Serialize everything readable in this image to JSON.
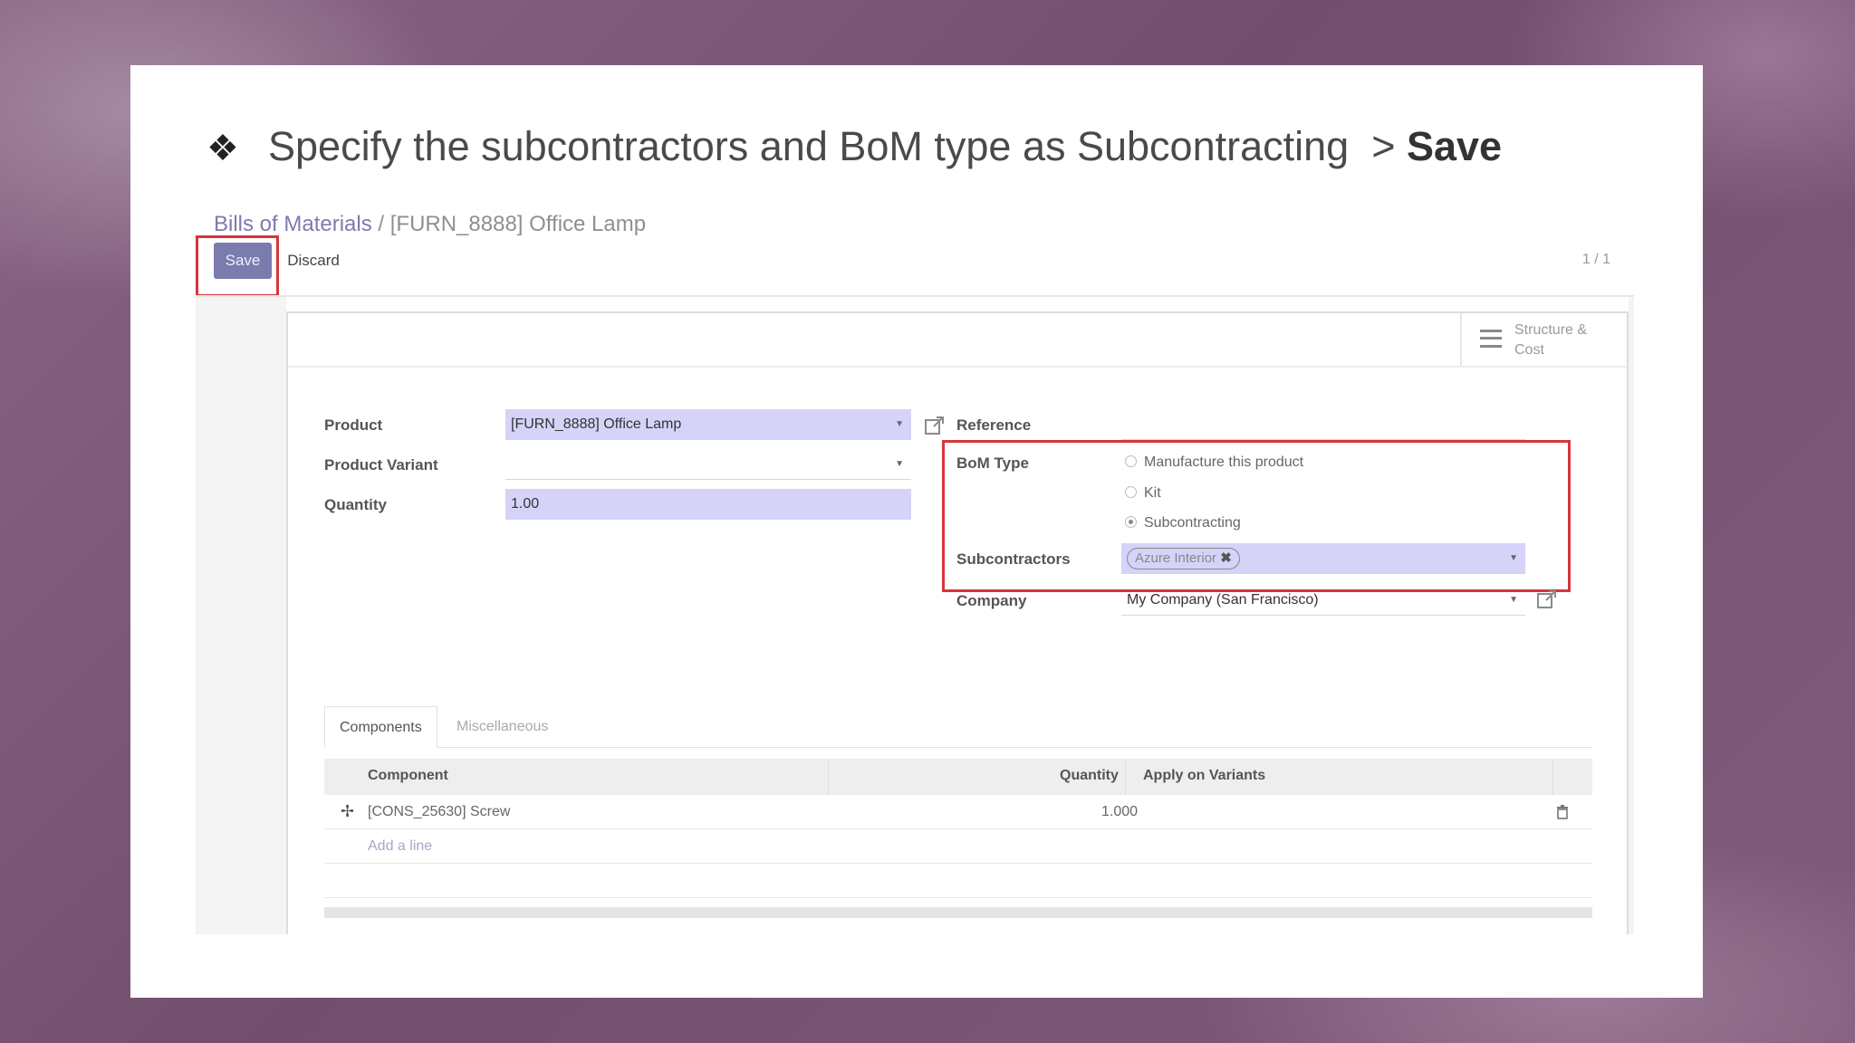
{
  "slide": {
    "bullet_icon": "❖",
    "title_main": "Specify the subcontractors and BoM type as Subcontracting",
    "title_arrow": ">",
    "title_bold": "Save"
  },
  "breadcrumb": {
    "parent": "Bills of Materials",
    "separator": "/",
    "current": "[FURN_8888] Office Lamp"
  },
  "toolbar": {
    "save_label": "Save",
    "discard_label": "Discard",
    "pager": "1 / 1"
  },
  "smart_button": {
    "icon": "bars-icon",
    "line1": "Structure &",
    "line2": "Cost"
  },
  "form": {
    "product_label": "Product",
    "product_value": "[FURN_8888] Office Lamp",
    "variant_label": "Product Variant",
    "variant_value": "",
    "quantity_label": "Quantity",
    "quantity_value": "1.00",
    "reference_label": "Reference",
    "reference_value": "",
    "bom_type_label": "BoM Type",
    "bom_options": [
      "Manufacture this product",
      "Kit",
      "Subcontracting"
    ],
    "bom_selected": "Subcontracting",
    "subcontractors_label": "Subcontractors",
    "subcontractor_tag": "Azure Interior",
    "company_label": "Company",
    "company_value": "My Company (San Francisco)"
  },
  "tabs": [
    "Components",
    "Miscellaneous"
  ],
  "table": {
    "headers": [
      "Component",
      "Quantity",
      "Apply on Variants"
    ],
    "rows": [
      {
        "component": "[CONS_25630] Screw",
        "quantity": "1.000"
      }
    ],
    "add_line": "Add a line"
  },
  "colors": {
    "highlight": "#d9343c",
    "accent": "#7c7bad",
    "field_bg": "#d5d3f8"
  }
}
